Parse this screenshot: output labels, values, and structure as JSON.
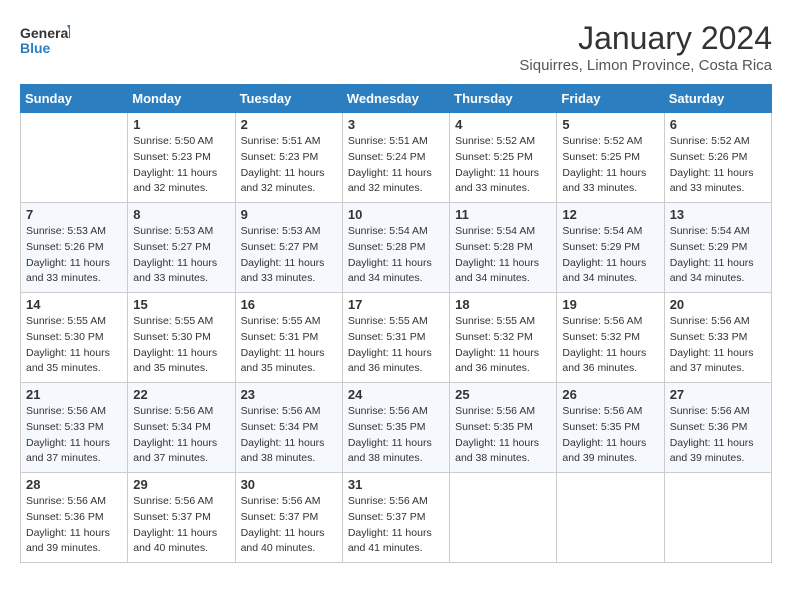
{
  "logo": {
    "general": "General",
    "blue": "Blue"
  },
  "title": "January 2024",
  "location": "Siquirres, Limon Province, Costa Rica",
  "days_of_week": [
    "Sunday",
    "Monday",
    "Tuesday",
    "Wednesday",
    "Thursday",
    "Friday",
    "Saturday"
  ],
  "weeks": [
    [
      {
        "day": "",
        "info": ""
      },
      {
        "day": "1",
        "info": "Sunrise: 5:50 AM\nSunset: 5:23 PM\nDaylight: 11 hours\nand 32 minutes."
      },
      {
        "day": "2",
        "info": "Sunrise: 5:51 AM\nSunset: 5:23 PM\nDaylight: 11 hours\nand 32 minutes."
      },
      {
        "day": "3",
        "info": "Sunrise: 5:51 AM\nSunset: 5:24 PM\nDaylight: 11 hours\nand 32 minutes."
      },
      {
        "day": "4",
        "info": "Sunrise: 5:52 AM\nSunset: 5:25 PM\nDaylight: 11 hours\nand 33 minutes."
      },
      {
        "day": "5",
        "info": "Sunrise: 5:52 AM\nSunset: 5:25 PM\nDaylight: 11 hours\nand 33 minutes."
      },
      {
        "day": "6",
        "info": "Sunrise: 5:52 AM\nSunset: 5:26 PM\nDaylight: 11 hours\nand 33 minutes."
      }
    ],
    [
      {
        "day": "7",
        "info": "Sunrise: 5:53 AM\nSunset: 5:26 PM\nDaylight: 11 hours\nand 33 minutes."
      },
      {
        "day": "8",
        "info": "Sunrise: 5:53 AM\nSunset: 5:27 PM\nDaylight: 11 hours\nand 33 minutes."
      },
      {
        "day": "9",
        "info": "Sunrise: 5:53 AM\nSunset: 5:27 PM\nDaylight: 11 hours\nand 33 minutes."
      },
      {
        "day": "10",
        "info": "Sunrise: 5:54 AM\nSunset: 5:28 PM\nDaylight: 11 hours\nand 34 minutes."
      },
      {
        "day": "11",
        "info": "Sunrise: 5:54 AM\nSunset: 5:28 PM\nDaylight: 11 hours\nand 34 minutes."
      },
      {
        "day": "12",
        "info": "Sunrise: 5:54 AM\nSunset: 5:29 PM\nDaylight: 11 hours\nand 34 minutes."
      },
      {
        "day": "13",
        "info": "Sunrise: 5:54 AM\nSunset: 5:29 PM\nDaylight: 11 hours\nand 34 minutes."
      }
    ],
    [
      {
        "day": "14",
        "info": "Sunrise: 5:55 AM\nSunset: 5:30 PM\nDaylight: 11 hours\nand 35 minutes."
      },
      {
        "day": "15",
        "info": "Sunrise: 5:55 AM\nSunset: 5:30 PM\nDaylight: 11 hours\nand 35 minutes."
      },
      {
        "day": "16",
        "info": "Sunrise: 5:55 AM\nSunset: 5:31 PM\nDaylight: 11 hours\nand 35 minutes."
      },
      {
        "day": "17",
        "info": "Sunrise: 5:55 AM\nSunset: 5:31 PM\nDaylight: 11 hours\nand 36 minutes."
      },
      {
        "day": "18",
        "info": "Sunrise: 5:55 AM\nSunset: 5:32 PM\nDaylight: 11 hours\nand 36 minutes."
      },
      {
        "day": "19",
        "info": "Sunrise: 5:56 AM\nSunset: 5:32 PM\nDaylight: 11 hours\nand 36 minutes."
      },
      {
        "day": "20",
        "info": "Sunrise: 5:56 AM\nSunset: 5:33 PM\nDaylight: 11 hours\nand 37 minutes."
      }
    ],
    [
      {
        "day": "21",
        "info": "Sunrise: 5:56 AM\nSunset: 5:33 PM\nDaylight: 11 hours\nand 37 minutes."
      },
      {
        "day": "22",
        "info": "Sunrise: 5:56 AM\nSunset: 5:34 PM\nDaylight: 11 hours\nand 37 minutes."
      },
      {
        "day": "23",
        "info": "Sunrise: 5:56 AM\nSunset: 5:34 PM\nDaylight: 11 hours\nand 38 minutes."
      },
      {
        "day": "24",
        "info": "Sunrise: 5:56 AM\nSunset: 5:35 PM\nDaylight: 11 hours\nand 38 minutes."
      },
      {
        "day": "25",
        "info": "Sunrise: 5:56 AM\nSunset: 5:35 PM\nDaylight: 11 hours\nand 38 minutes."
      },
      {
        "day": "26",
        "info": "Sunrise: 5:56 AM\nSunset: 5:35 PM\nDaylight: 11 hours\nand 39 minutes."
      },
      {
        "day": "27",
        "info": "Sunrise: 5:56 AM\nSunset: 5:36 PM\nDaylight: 11 hours\nand 39 minutes."
      }
    ],
    [
      {
        "day": "28",
        "info": "Sunrise: 5:56 AM\nSunset: 5:36 PM\nDaylight: 11 hours\nand 39 minutes."
      },
      {
        "day": "29",
        "info": "Sunrise: 5:56 AM\nSunset: 5:37 PM\nDaylight: 11 hours\nand 40 minutes."
      },
      {
        "day": "30",
        "info": "Sunrise: 5:56 AM\nSunset: 5:37 PM\nDaylight: 11 hours\nand 40 minutes."
      },
      {
        "day": "31",
        "info": "Sunrise: 5:56 AM\nSunset: 5:37 PM\nDaylight: 11 hours\nand 41 minutes."
      },
      {
        "day": "",
        "info": ""
      },
      {
        "day": "",
        "info": ""
      },
      {
        "day": "",
        "info": ""
      }
    ]
  ]
}
